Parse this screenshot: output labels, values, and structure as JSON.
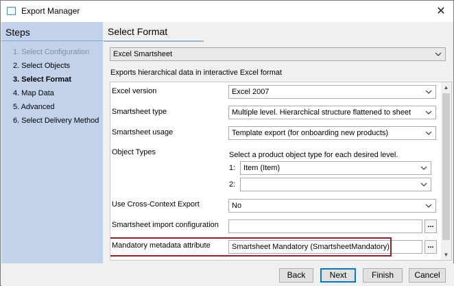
{
  "window": {
    "title": "Export Manager"
  },
  "steps": {
    "heading": "Steps",
    "items": [
      {
        "label": "1. Select Configuration",
        "state": "done"
      },
      {
        "label": "2. Select Objects",
        "state": "normal"
      },
      {
        "label": "3. Select Format",
        "state": "current"
      },
      {
        "label": "4. Map Data",
        "state": "normal"
      },
      {
        "label": "5. Advanced",
        "state": "normal"
      },
      {
        "label": "6. Select Delivery Method",
        "state": "normal"
      }
    ]
  },
  "main": {
    "heading": "Select Format",
    "format_select": "Excel Smartsheet",
    "description": "Exports hierarchical data in interactive Excel format",
    "form": {
      "excel_version": {
        "label": "Excel version",
        "value": "Excel 2007"
      },
      "smartsheet_type": {
        "label": "Smartsheet type",
        "value": "Multiple level. Hierarchical structure flattened to sheet"
      },
      "smartsheet_usage": {
        "label": "Smartsheet usage",
        "value": "Template export (for onboarding new products)"
      },
      "object_types": {
        "label": "Object Types",
        "instruction": "Select a product object type for each desired level.",
        "levels": [
          {
            "num": "1:",
            "value": "Item (Item)"
          },
          {
            "num": "2:",
            "value": ""
          }
        ]
      },
      "cross_context": {
        "label": "Use Cross-Context Export",
        "value": "No"
      },
      "import_config": {
        "label": "Smartsheet import configuration",
        "value": "",
        "browse": "..."
      },
      "mandatory_attr": {
        "label": "Mandatory metadata attribute",
        "value": "Smartsheet Mandatory (SmartsheetMandatory)",
        "browse": "..."
      }
    }
  },
  "footer": {
    "back": "Back",
    "next": "Next",
    "finish": "Finish",
    "cancel": "Cancel"
  },
  "colors": {
    "sidebar_bg": "#c2d2ea",
    "highlight_border": "#9a1c24",
    "default_button_border": "#0078d7"
  }
}
